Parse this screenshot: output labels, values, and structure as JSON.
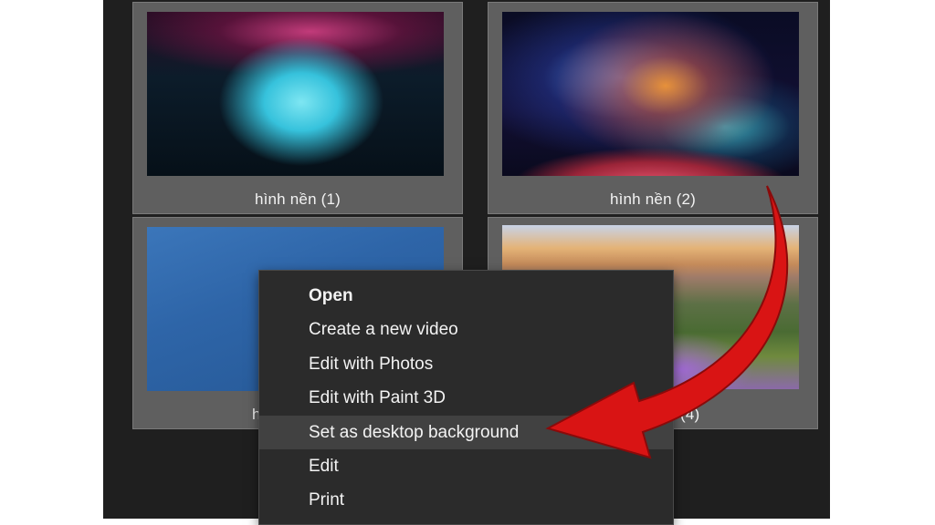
{
  "tiles": [
    {
      "label": "hình nền (1)"
    },
    {
      "label": "hình nền (2)"
    },
    {
      "label": "h"
    },
    {
      "label": "(4)"
    }
  ],
  "context_menu": {
    "items": [
      {
        "label": "Open",
        "bold": true
      },
      {
        "label": "Create a new video"
      },
      {
        "label": "Edit with Photos"
      },
      {
        "label": "Edit with Paint 3D"
      },
      {
        "label": "Set as desktop background",
        "highlighted": true
      },
      {
        "label": "Edit"
      },
      {
        "label": "Print"
      }
    ]
  },
  "colors": {
    "window_bg": "#1f1f1f",
    "tile_bg": "#5f5f5f",
    "menu_bg": "#2b2b2b",
    "menu_hover": "#414141",
    "arrow": "#d91414"
  },
  "annotation": {
    "icon": "red-curved-arrow-icon"
  }
}
